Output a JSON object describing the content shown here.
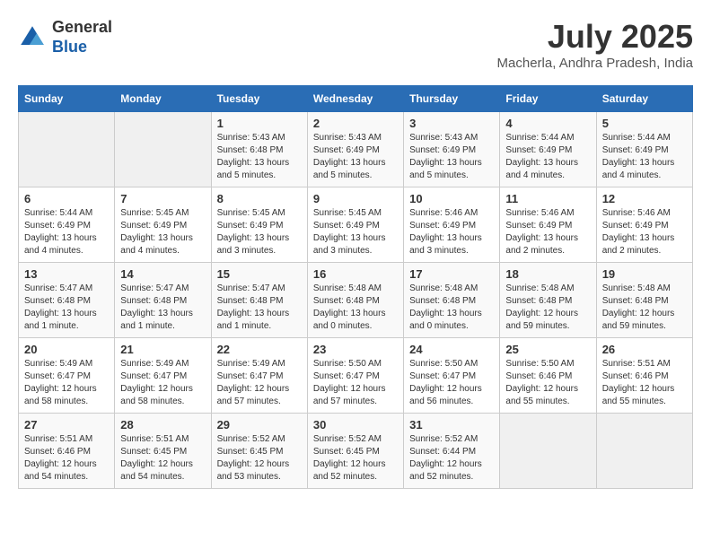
{
  "header": {
    "logo_line1": "General",
    "logo_line2": "Blue",
    "month_year": "July 2025",
    "location": "Macherla, Andhra Pradesh, India"
  },
  "weekdays": [
    "Sunday",
    "Monday",
    "Tuesday",
    "Wednesday",
    "Thursday",
    "Friday",
    "Saturday"
  ],
  "weeks": [
    [
      {
        "day": "",
        "info": ""
      },
      {
        "day": "",
        "info": ""
      },
      {
        "day": "1",
        "info": "Sunrise: 5:43 AM\nSunset: 6:48 PM\nDaylight: 13 hours\nand 5 minutes."
      },
      {
        "day": "2",
        "info": "Sunrise: 5:43 AM\nSunset: 6:49 PM\nDaylight: 13 hours\nand 5 minutes."
      },
      {
        "day": "3",
        "info": "Sunrise: 5:43 AM\nSunset: 6:49 PM\nDaylight: 13 hours\nand 5 minutes."
      },
      {
        "day": "4",
        "info": "Sunrise: 5:44 AM\nSunset: 6:49 PM\nDaylight: 13 hours\nand 4 minutes."
      },
      {
        "day": "5",
        "info": "Sunrise: 5:44 AM\nSunset: 6:49 PM\nDaylight: 13 hours\nand 4 minutes."
      }
    ],
    [
      {
        "day": "6",
        "info": "Sunrise: 5:44 AM\nSunset: 6:49 PM\nDaylight: 13 hours\nand 4 minutes."
      },
      {
        "day": "7",
        "info": "Sunrise: 5:45 AM\nSunset: 6:49 PM\nDaylight: 13 hours\nand 4 minutes."
      },
      {
        "day": "8",
        "info": "Sunrise: 5:45 AM\nSunset: 6:49 PM\nDaylight: 13 hours\nand 3 minutes."
      },
      {
        "day": "9",
        "info": "Sunrise: 5:45 AM\nSunset: 6:49 PM\nDaylight: 13 hours\nand 3 minutes."
      },
      {
        "day": "10",
        "info": "Sunrise: 5:46 AM\nSunset: 6:49 PM\nDaylight: 13 hours\nand 3 minutes."
      },
      {
        "day": "11",
        "info": "Sunrise: 5:46 AM\nSunset: 6:49 PM\nDaylight: 13 hours\nand 2 minutes."
      },
      {
        "day": "12",
        "info": "Sunrise: 5:46 AM\nSunset: 6:49 PM\nDaylight: 13 hours\nand 2 minutes."
      }
    ],
    [
      {
        "day": "13",
        "info": "Sunrise: 5:47 AM\nSunset: 6:48 PM\nDaylight: 13 hours\nand 1 minute."
      },
      {
        "day": "14",
        "info": "Sunrise: 5:47 AM\nSunset: 6:48 PM\nDaylight: 13 hours\nand 1 minute."
      },
      {
        "day": "15",
        "info": "Sunrise: 5:47 AM\nSunset: 6:48 PM\nDaylight: 13 hours\nand 1 minute."
      },
      {
        "day": "16",
        "info": "Sunrise: 5:48 AM\nSunset: 6:48 PM\nDaylight: 13 hours\nand 0 minutes."
      },
      {
        "day": "17",
        "info": "Sunrise: 5:48 AM\nSunset: 6:48 PM\nDaylight: 13 hours\nand 0 minutes."
      },
      {
        "day": "18",
        "info": "Sunrise: 5:48 AM\nSunset: 6:48 PM\nDaylight: 12 hours\nand 59 minutes."
      },
      {
        "day": "19",
        "info": "Sunrise: 5:48 AM\nSunset: 6:48 PM\nDaylight: 12 hours\nand 59 minutes."
      }
    ],
    [
      {
        "day": "20",
        "info": "Sunrise: 5:49 AM\nSunset: 6:47 PM\nDaylight: 12 hours\nand 58 minutes."
      },
      {
        "day": "21",
        "info": "Sunrise: 5:49 AM\nSunset: 6:47 PM\nDaylight: 12 hours\nand 58 minutes."
      },
      {
        "day": "22",
        "info": "Sunrise: 5:49 AM\nSunset: 6:47 PM\nDaylight: 12 hours\nand 57 minutes."
      },
      {
        "day": "23",
        "info": "Sunrise: 5:50 AM\nSunset: 6:47 PM\nDaylight: 12 hours\nand 57 minutes."
      },
      {
        "day": "24",
        "info": "Sunrise: 5:50 AM\nSunset: 6:47 PM\nDaylight: 12 hours\nand 56 minutes."
      },
      {
        "day": "25",
        "info": "Sunrise: 5:50 AM\nSunset: 6:46 PM\nDaylight: 12 hours\nand 55 minutes."
      },
      {
        "day": "26",
        "info": "Sunrise: 5:51 AM\nSunset: 6:46 PM\nDaylight: 12 hours\nand 55 minutes."
      }
    ],
    [
      {
        "day": "27",
        "info": "Sunrise: 5:51 AM\nSunset: 6:46 PM\nDaylight: 12 hours\nand 54 minutes."
      },
      {
        "day": "28",
        "info": "Sunrise: 5:51 AM\nSunset: 6:45 PM\nDaylight: 12 hours\nand 54 minutes."
      },
      {
        "day": "29",
        "info": "Sunrise: 5:52 AM\nSunset: 6:45 PM\nDaylight: 12 hours\nand 53 minutes."
      },
      {
        "day": "30",
        "info": "Sunrise: 5:52 AM\nSunset: 6:45 PM\nDaylight: 12 hours\nand 52 minutes."
      },
      {
        "day": "31",
        "info": "Sunrise: 5:52 AM\nSunset: 6:44 PM\nDaylight: 12 hours\nand 52 minutes."
      },
      {
        "day": "",
        "info": ""
      },
      {
        "day": "",
        "info": ""
      }
    ]
  ]
}
